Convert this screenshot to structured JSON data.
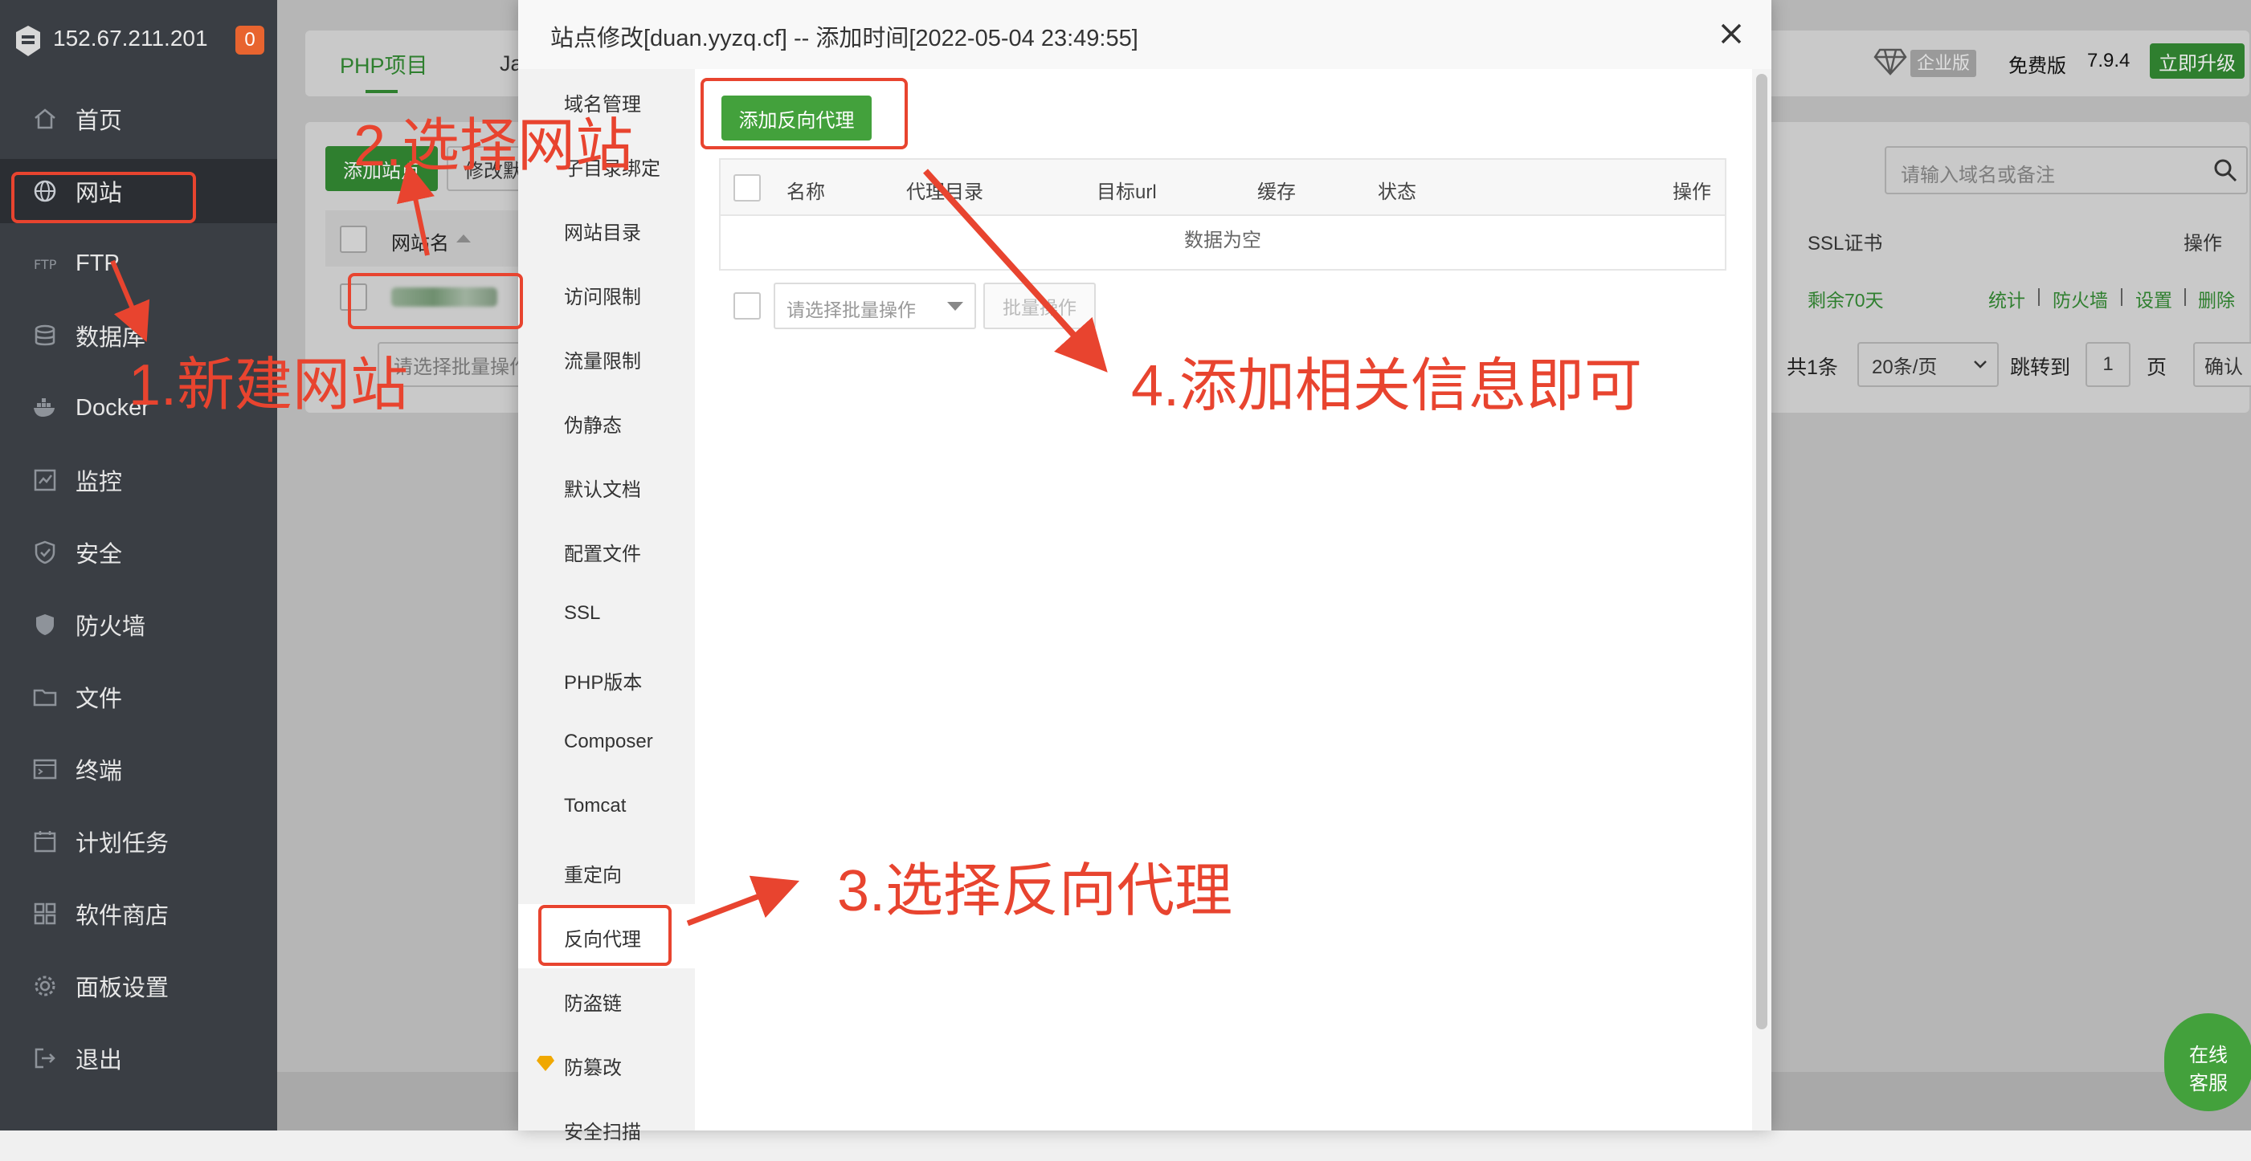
{
  "sidebar": {
    "ip": "152.67.211.201",
    "badge": "0",
    "items": [
      {
        "label": "首页",
        "icon": "home-icon"
      },
      {
        "label": "网站",
        "icon": "globe-icon"
      },
      {
        "label": "FTP",
        "icon": "ftp-icon"
      },
      {
        "label": "数据库",
        "icon": "database-icon"
      },
      {
        "label": "Docker",
        "icon": "docker-icon"
      },
      {
        "label": "监控",
        "icon": "monitor-icon"
      },
      {
        "label": "安全",
        "icon": "shield-icon"
      },
      {
        "label": "防火墙",
        "icon": "firewall-icon"
      },
      {
        "label": "文件",
        "icon": "folder-icon"
      },
      {
        "label": "终端",
        "icon": "terminal-icon"
      },
      {
        "label": "计划任务",
        "icon": "calendar-icon"
      },
      {
        "label": "软件商店",
        "icon": "apps-icon"
      },
      {
        "label": "面板设置",
        "icon": "gear-icon"
      },
      {
        "label": "退出",
        "icon": "logout-icon"
      }
    ]
  },
  "topbar": {
    "tab_php": "PHP项目",
    "tab_java": "Ja",
    "enterprise": "企业版",
    "free": "免费版",
    "version": "7.9.4",
    "upgrade": "立即升级"
  },
  "sites": {
    "add_site": "添加站点",
    "modify_default": "修改默",
    "col_name": "网站名",
    "col_ssl": "SSL证书",
    "col_ops": "操作",
    "search_placeholder": "请输入域名或备注",
    "ssl_remaining": "剩余70天",
    "op_stats": "统计",
    "op_firewall": "防火墙",
    "op_settings": "设置",
    "op_delete": "删除",
    "batch_placeholder": "请选择批量操作",
    "total": "共1条",
    "per_page": "20条/页",
    "goto": "跳转到",
    "page": "1",
    "page_unit": "页",
    "confirm": "确认"
  },
  "modal": {
    "title": "站点修改[duan.yyzq.cf] -- 添加时间[2022-05-04 23:49:55]",
    "nav": [
      "域名管理",
      "子目录绑定",
      "网站目录",
      "访问限制",
      "流量限制",
      "伪静态",
      "默认文档",
      "配置文件",
      "SSL",
      "PHP版本",
      "Composer",
      "Tomcat",
      "重定向",
      "反向代理",
      "防盗链",
      "防篡改",
      "安全扫描"
    ],
    "add_proxy": "添加反向代理",
    "columns": [
      "名称",
      "代理目录",
      "目标url",
      "缓存",
      "状态",
      "操作"
    ],
    "empty": "数据为空",
    "batch_placeholder": "请选择批量操作",
    "batch_button": "批量操作"
  },
  "annotations": {
    "step1": "1.新建网站",
    "step2": "2.选择网站",
    "step3": "3.选择反向代理",
    "step4": "4.添加相关信息即可"
  },
  "service": {
    "line1": "在线",
    "line2": "客服"
  },
  "colors": {
    "sidebar_bg": "#3a3e44",
    "accent_green": "#43a13c",
    "annotation_red": "#e8442f",
    "badge_orange": "#e8642f"
  }
}
